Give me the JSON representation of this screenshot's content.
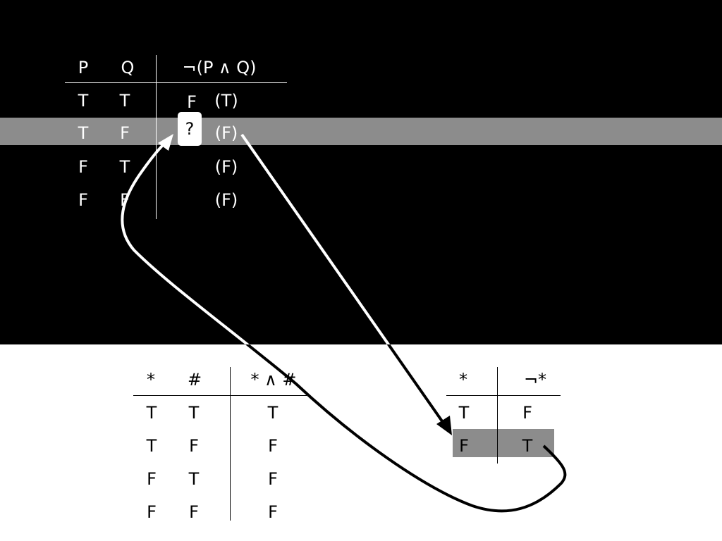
{
  "top_table": {
    "headers": [
      "P",
      "Q",
      "¬(P ∧ Q)"
    ],
    "rows": [
      {
        "p": "T",
        "q": "T",
        "result": "F",
        "paren": "(T)"
      },
      {
        "p": "T",
        "q": "F",
        "result": "?",
        "paren": "(F)"
      },
      {
        "p": "F",
        "q": "T",
        "result": "",
        "paren": "(F)"
      },
      {
        "p": "F",
        "q": "F",
        "result": "",
        "paren": "(F)"
      }
    ]
  },
  "and_table": {
    "headers": [
      "*",
      "#",
      "* ∧ #"
    ],
    "rows": [
      [
        "T",
        "T",
        "T"
      ],
      [
        "T",
        "F",
        "F"
      ],
      [
        "F",
        "T",
        "F"
      ],
      [
        "F",
        "F",
        "F"
      ]
    ]
  },
  "not_table": {
    "headers": [
      "*",
      "¬*"
    ],
    "rows": [
      [
        "T",
        "F"
      ],
      [
        "F",
        "T"
      ]
    ]
  },
  "colors": {
    "top_background": "#000000",
    "bottom_background": "#ffffff",
    "highlight": "#8c8c8c"
  }
}
